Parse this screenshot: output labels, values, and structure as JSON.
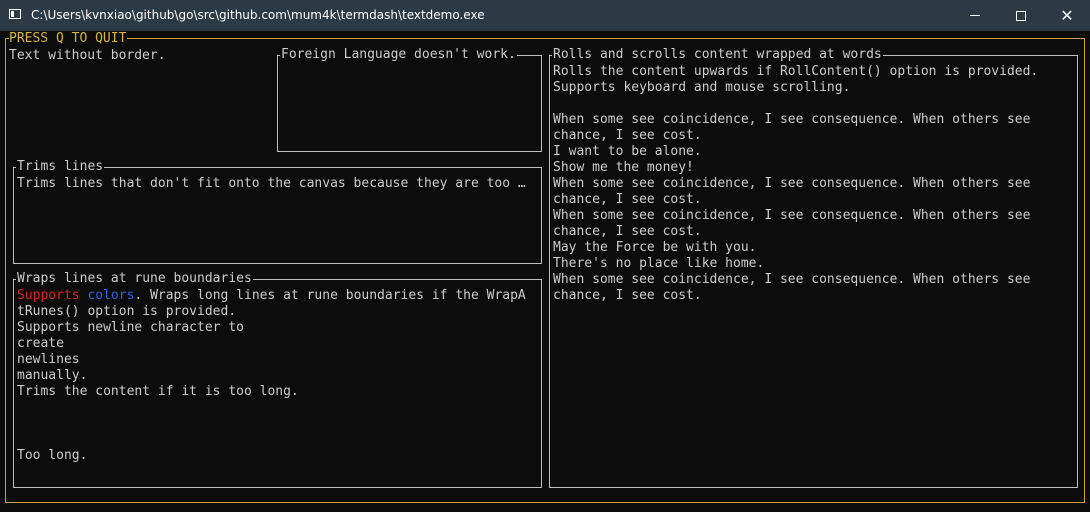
{
  "window": {
    "title": "C:\\Users\\kvnxiao\\github\\go\\src\\github.com\\mum4k\\termdash\\textdemo.exe",
    "minimize_icon": "minimize-icon",
    "maximize_icon": "maximize-icon",
    "close_icon": "close-icon",
    "close_glyph": "✕"
  },
  "outer": {
    "title": "PRESS Q TO QUIT"
  },
  "plain": {
    "text": "Text without border."
  },
  "foreign": {
    "title": "Foreign Language doesn't work."
  },
  "trims": {
    "title": "Trims lines",
    "text": "Trims lines that don't fit onto the canvas because they are too …"
  },
  "wraps": {
    "title": "Wraps lines at rune boundaries",
    "red_word": "Supports",
    "blue_word": "colors",
    "line1_rest": ". Wraps long lines at rune boundaries if the WrapA",
    "lines": [
      "tRunes() option is provided.",
      "Supports newline character to",
      "create",
      "newlines",
      "manually.",
      "Trims the content if it is too long.",
      "",
      "",
      "",
      "Too long."
    ]
  },
  "rolls": {
    "title": "Rolls and scrolls content wrapped at words",
    "lines": [
      "Rolls the content upwards if RollContent() option is provided.",
      "Supports keyboard and mouse scrolling.",
      "",
      "When some see coincidence, I see consequence. When others see",
      "chance, I see cost.",
      "I want to be alone.",
      "Show me the money!",
      "When some see coincidence, I see consequence. When others see",
      "chance, I see cost.",
      "When some see coincidence, I see consequence. When others see",
      "chance, I see cost.",
      "May the Force be with you.",
      "There's no place like home.",
      "When some see coincidence, I see consequence. When others see",
      "chance, I see cost."
    ]
  },
  "colors": {
    "border_outer": "#c7a33a",
    "border_inner": "#bfbfbf",
    "red": "#e02020",
    "blue": "#2f5fe0",
    "background": "#0c0c0c",
    "titlebar": "#2b3a45"
  }
}
